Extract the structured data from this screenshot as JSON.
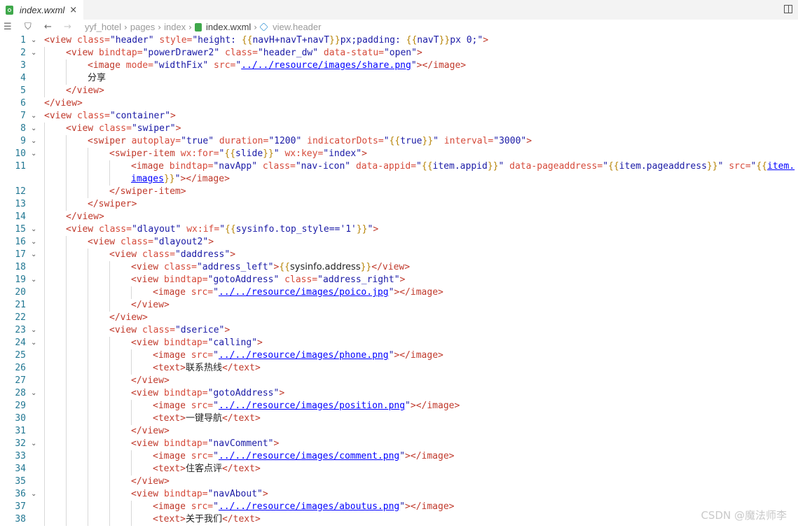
{
  "tab": {
    "filename": "index.wxml",
    "close": "×"
  },
  "breadcrumb": {
    "items": [
      "yyf_hotel",
      "pages",
      "index",
      "index.wxml",
      "view.header"
    ],
    "separator": "›"
  },
  "watermark": "CSDN @魔法师李",
  "lines": [
    {
      "n": "1",
      "indent": 0,
      "fold": true,
      "code": [
        [
          "tg",
          "<view"
        ],
        [
          "at",
          " class="
        ],
        [
          "st",
          "\"header\""
        ],
        [
          "at",
          " style="
        ],
        [
          "st",
          "\"height: "
        ],
        [
          "br",
          "{{"
        ],
        [
          "st",
          "navH+navT+navT"
        ],
        [
          "br",
          "}}"
        ],
        [
          "st",
          "px;padding: "
        ],
        [
          "br",
          "{{"
        ],
        [
          "st",
          "navT"
        ],
        [
          "br",
          "}}"
        ],
        [
          "st",
          "px 0;\""
        ],
        [
          "tg",
          ">"
        ]
      ]
    },
    {
      "n": "2",
      "indent": 1,
      "fold": true,
      "code": [
        [
          "tg",
          "<view"
        ],
        [
          "at",
          " bindtap="
        ],
        [
          "st",
          "\"powerDrawer2\""
        ],
        [
          "at",
          " class="
        ],
        [
          "st",
          "\"header_dw\""
        ],
        [
          "at",
          " data-statu="
        ],
        [
          "st",
          "\"open\""
        ],
        [
          "tg",
          ">"
        ]
      ]
    },
    {
      "n": "3",
      "indent": 2,
      "fold": false,
      "code": [
        [
          "tg",
          "<image"
        ],
        [
          "at",
          " mode="
        ],
        [
          "st",
          "\"widthFix\""
        ],
        [
          "at",
          " src="
        ],
        [
          "st",
          "\""
        ],
        [
          "u",
          "../../resource/images/share.png"
        ],
        [
          "st",
          "\""
        ],
        [
          "tg",
          "></image>"
        ]
      ]
    },
    {
      "n": "4",
      "indent": 2,
      "fold": false,
      "code": [
        [
          "cn",
          "分享"
        ]
      ]
    },
    {
      "n": "5",
      "indent": 1,
      "fold": false,
      "code": [
        [
          "tg",
          "</view>"
        ]
      ]
    },
    {
      "n": "6",
      "indent": 0,
      "fold": false,
      "code": [
        [
          "tg",
          "</view>"
        ]
      ]
    },
    {
      "n": "7",
      "indent": 0,
      "fold": true,
      "code": [
        [
          "tg",
          "<view"
        ],
        [
          "at",
          " class="
        ],
        [
          "st",
          "\"container\""
        ],
        [
          "tg",
          ">"
        ]
      ]
    },
    {
      "n": "8",
      "indent": 1,
      "fold": true,
      "code": [
        [
          "tg",
          "<view"
        ],
        [
          "at",
          " class="
        ],
        [
          "st",
          "\"swiper\""
        ],
        [
          "tg",
          ">"
        ]
      ]
    },
    {
      "n": "9",
      "indent": 2,
      "fold": true,
      "code": [
        [
          "tg",
          "<swiper"
        ],
        [
          "at",
          " autoplay="
        ],
        [
          "st",
          "\"true\""
        ],
        [
          "at",
          " duration="
        ],
        [
          "st",
          "\"1200\""
        ],
        [
          "at",
          " indicatorDots="
        ],
        [
          "st",
          "\""
        ],
        [
          "br",
          "{{"
        ],
        [
          "st",
          "true"
        ],
        [
          "br",
          "}}"
        ],
        [
          "st",
          "\""
        ],
        [
          "at",
          " interval="
        ],
        [
          "st",
          "\"3000\""
        ],
        [
          "tg",
          ">"
        ]
      ]
    },
    {
      "n": "10",
      "indent": 3,
      "fold": true,
      "code": [
        [
          "tg",
          "<swiper-item"
        ],
        [
          "at",
          " wx:for="
        ],
        [
          "st",
          "\""
        ],
        [
          "br",
          "{{"
        ],
        [
          "st",
          "slide"
        ],
        [
          "br",
          "}}"
        ],
        [
          "st",
          "\""
        ],
        [
          "at",
          " wx:key="
        ],
        [
          "st",
          "\"index\""
        ],
        [
          "tg",
          ">"
        ]
      ]
    },
    {
      "n": "11",
      "indent": 4,
      "fold": false,
      "code": [
        [
          "tg",
          "<image"
        ],
        [
          "at",
          " bindtap="
        ],
        [
          "st",
          "\"navApp\""
        ],
        [
          "at",
          " class="
        ],
        [
          "st",
          "\"nav-icon\""
        ],
        [
          "at",
          " data-appid="
        ],
        [
          "st",
          "\""
        ],
        [
          "br",
          "{{"
        ],
        [
          "st",
          "item.appid"
        ],
        [
          "br",
          "}}"
        ],
        [
          "st",
          "\""
        ],
        [
          "at",
          " data-pageaddress="
        ],
        [
          "st",
          "\""
        ],
        [
          "br",
          "{{"
        ],
        [
          "st",
          "item.pageaddress"
        ],
        [
          "br",
          "}}"
        ],
        [
          "st",
          "\""
        ],
        [
          "at",
          " src="
        ],
        [
          "st",
          "\""
        ],
        [
          "br",
          "{{"
        ],
        [
          "u",
          "item."
        ]
      ]
    },
    {
      "n": "",
      "indent": 4,
      "fold": false,
      "code": [
        [
          "u",
          "images"
        ],
        [
          "br",
          "}}"
        ],
        [
          "st",
          "\""
        ],
        [
          "tg",
          "></image>"
        ]
      ]
    },
    {
      "n": "12",
      "indent": 3,
      "fold": false,
      "code": [
        [
          "tg",
          "</swiper-item>"
        ]
      ]
    },
    {
      "n": "13",
      "indent": 2,
      "fold": false,
      "code": [
        [
          "tg",
          "</swiper>"
        ]
      ]
    },
    {
      "n": "14",
      "indent": 1,
      "fold": false,
      "code": [
        [
          "tg",
          "</view>"
        ]
      ]
    },
    {
      "n": "15",
      "indent": 1,
      "fold": true,
      "code": [
        [
          "tg",
          "<view"
        ],
        [
          "at",
          " class="
        ],
        [
          "st",
          "\"dlayout\""
        ],
        [
          "at",
          " wx:if="
        ],
        [
          "st",
          "\""
        ],
        [
          "br",
          "{{"
        ],
        [
          "st",
          "sysinfo.top_style=='1'"
        ],
        [
          "br",
          "}}"
        ],
        [
          "st",
          "\""
        ],
        [
          "tg",
          ">"
        ]
      ]
    },
    {
      "n": "16",
      "indent": 2,
      "fold": true,
      "code": [
        [
          "tg",
          "<view"
        ],
        [
          "at",
          " class="
        ],
        [
          "st",
          "\"dlayout2\""
        ],
        [
          "tg",
          ">"
        ]
      ]
    },
    {
      "n": "17",
      "indent": 3,
      "fold": true,
      "code": [
        [
          "tg",
          "<view"
        ],
        [
          "at",
          " class="
        ],
        [
          "st",
          "\"daddress\""
        ],
        [
          "tg",
          ">"
        ]
      ]
    },
    {
      "n": "18",
      "indent": 4,
      "fold": false,
      "code": [
        [
          "tg",
          "<view"
        ],
        [
          "at",
          " class="
        ],
        [
          "st",
          "\"address_left\""
        ],
        [
          "tg",
          ">"
        ],
        [
          "br",
          "{{"
        ],
        [
          "cn",
          "sysinfo.address"
        ],
        [
          "br",
          "}}"
        ],
        [
          "tg",
          "</view>"
        ]
      ]
    },
    {
      "n": "19",
      "indent": 4,
      "fold": true,
      "code": [
        [
          "tg",
          "<view"
        ],
        [
          "at",
          " bindtap="
        ],
        [
          "st",
          "\"gotoAddress\""
        ],
        [
          "at",
          " class="
        ],
        [
          "st",
          "\"address_right\""
        ],
        [
          "tg",
          ">"
        ]
      ]
    },
    {
      "n": "20",
      "indent": 5,
      "fold": false,
      "code": [
        [
          "tg",
          "<image"
        ],
        [
          "at",
          " src="
        ],
        [
          "st",
          "\""
        ],
        [
          "u",
          "../../resource/images/poico.jpg"
        ],
        [
          "st",
          "\""
        ],
        [
          "tg",
          "></image>"
        ]
      ]
    },
    {
      "n": "21",
      "indent": 4,
      "fold": false,
      "code": [
        [
          "tg",
          "</view>"
        ]
      ]
    },
    {
      "n": "22",
      "indent": 3,
      "fold": false,
      "code": [
        [
          "tg",
          "</view>"
        ]
      ]
    },
    {
      "n": "23",
      "indent": 3,
      "fold": true,
      "code": [
        [
          "tg",
          "<view"
        ],
        [
          "at",
          " class="
        ],
        [
          "st",
          "\"dserice\""
        ],
        [
          "tg",
          ">"
        ]
      ]
    },
    {
      "n": "24",
      "indent": 4,
      "fold": true,
      "code": [
        [
          "tg",
          "<view"
        ],
        [
          "at",
          " bindtap="
        ],
        [
          "st",
          "\"calling\""
        ],
        [
          "tg",
          ">"
        ]
      ]
    },
    {
      "n": "25",
      "indent": 5,
      "fold": false,
      "code": [
        [
          "tg",
          "<image"
        ],
        [
          "at",
          " src="
        ],
        [
          "st",
          "\""
        ],
        [
          "u",
          "../../resource/images/phone.png"
        ],
        [
          "st",
          "\""
        ],
        [
          "tg",
          "></image>"
        ]
      ]
    },
    {
      "n": "26",
      "indent": 5,
      "fold": false,
      "code": [
        [
          "tg",
          "<text>"
        ],
        [
          "cn",
          "联系热线"
        ],
        [
          "tg",
          "</text>"
        ]
      ]
    },
    {
      "n": "27",
      "indent": 4,
      "fold": false,
      "code": [
        [
          "tg",
          "</view>"
        ]
      ]
    },
    {
      "n": "28",
      "indent": 4,
      "fold": true,
      "code": [
        [
          "tg",
          "<view"
        ],
        [
          "at",
          " bindtap="
        ],
        [
          "st",
          "\"gotoAddress\""
        ],
        [
          "tg",
          ">"
        ]
      ]
    },
    {
      "n": "29",
      "indent": 5,
      "fold": false,
      "code": [
        [
          "tg",
          "<image"
        ],
        [
          "at",
          " src="
        ],
        [
          "st",
          "\""
        ],
        [
          "u",
          "../../resource/images/position.png"
        ],
        [
          "st",
          "\""
        ],
        [
          "tg",
          "></image>"
        ]
      ]
    },
    {
      "n": "30",
      "indent": 5,
      "fold": false,
      "code": [
        [
          "tg",
          "<text>"
        ],
        [
          "cn",
          "一键导航"
        ],
        [
          "tg",
          "</text>"
        ]
      ]
    },
    {
      "n": "31",
      "indent": 4,
      "fold": false,
      "code": [
        [
          "tg",
          "</view>"
        ]
      ]
    },
    {
      "n": "32",
      "indent": 4,
      "fold": true,
      "code": [
        [
          "tg",
          "<view"
        ],
        [
          "at",
          " bindtap="
        ],
        [
          "st",
          "\"navComment\""
        ],
        [
          "tg",
          ">"
        ]
      ]
    },
    {
      "n": "33",
      "indent": 5,
      "fold": false,
      "code": [
        [
          "tg",
          "<image"
        ],
        [
          "at",
          " src="
        ],
        [
          "st",
          "\""
        ],
        [
          "u",
          "../../resource/images/comment.png"
        ],
        [
          "st",
          "\""
        ],
        [
          "tg",
          "></image>"
        ]
      ]
    },
    {
      "n": "34",
      "indent": 5,
      "fold": false,
      "code": [
        [
          "tg",
          "<text>"
        ],
        [
          "cn",
          "住客点评"
        ],
        [
          "tg",
          "</text>"
        ]
      ]
    },
    {
      "n": "35",
      "indent": 4,
      "fold": false,
      "code": [
        [
          "tg",
          "</view>"
        ]
      ]
    },
    {
      "n": "36",
      "indent": 4,
      "fold": true,
      "code": [
        [
          "tg",
          "<view"
        ],
        [
          "at",
          " bindtap="
        ],
        [
          "st",
          "\"navAbout\""
        ],
        [
          "tg",
          ">"
        ]
      ]
    },
    {
      "n": "37",
      "indent": 5,
      "fold": false,
      "code": [
        [
          "tg",
          "<image"
        ],
        [
          "at",
          " src="
        ],
        [
          "st",
          "\""
        ],
        [
          "u",
          "../../resource/images/aboutus.png"
        ],
        [
          "st",
          "\""
        ],
        [
          "tg",
          "></image>"
        ]
      ]
    },
    {
      "n": "38",
      "indent": 5,
      "fold": false,
      "code": [
        [
          "tg",
          "<text>"
        ],
        [
          "cn",
          "关于我们"
        ],
        [
          "tg",
          "</text>"
        ]
      ]
    }
  ]
}
